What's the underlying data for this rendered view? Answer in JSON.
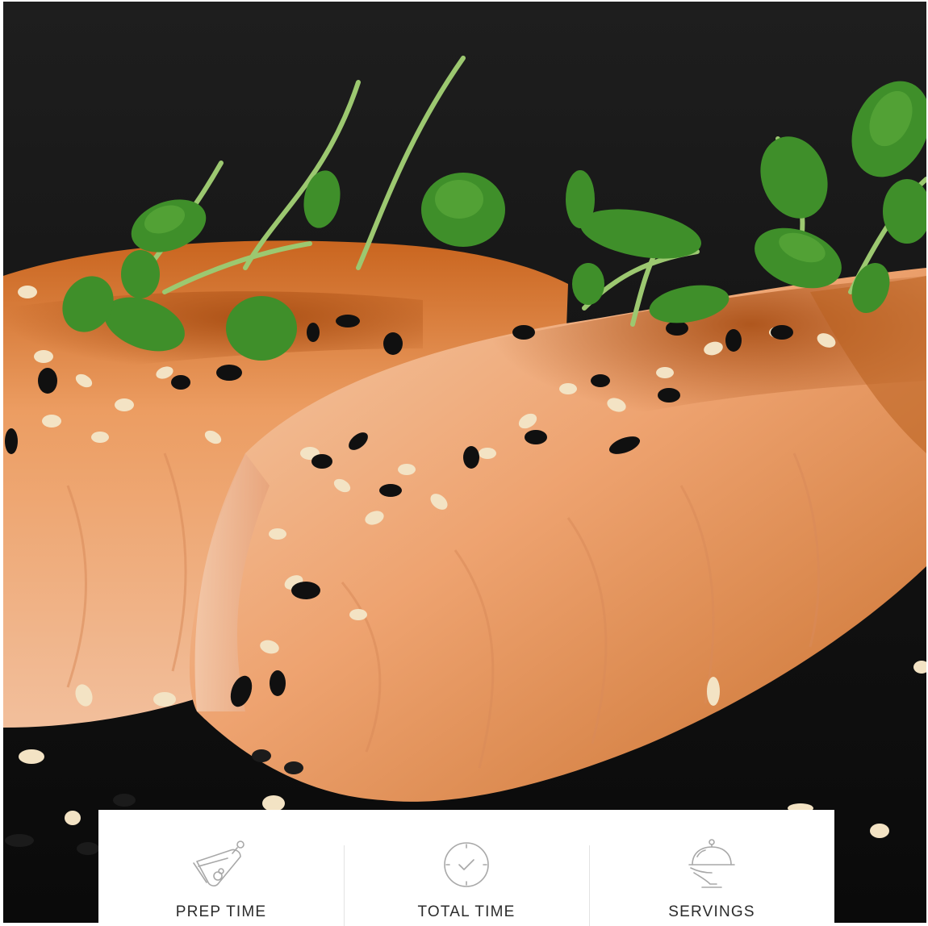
{
  "hero": {
    "image": "seared-salmon-fillets-with-sesame-and-microgreens"
  },
  "stats": [
    {
      "label": "PREP TIME",
      "icon": "cutting-board-icon"
    },
    {
      "label": "TOTAL TIME",
      "icon": "clock-icon"
    },
    {
      "label": "SERVINGS",
      "icon": "serving-cloche-icon"
    }
  ],
  "colors": {
    "background_dark": "#141414",
    "salmon": "#e8975a",
    "sear": "#b8561c",
    "herb": "#3f8f2a",
    "card": "#ffffff",
    "icon_stroke": "#a8a8a8",
    "label": "#2b2b2b"
  }
}
